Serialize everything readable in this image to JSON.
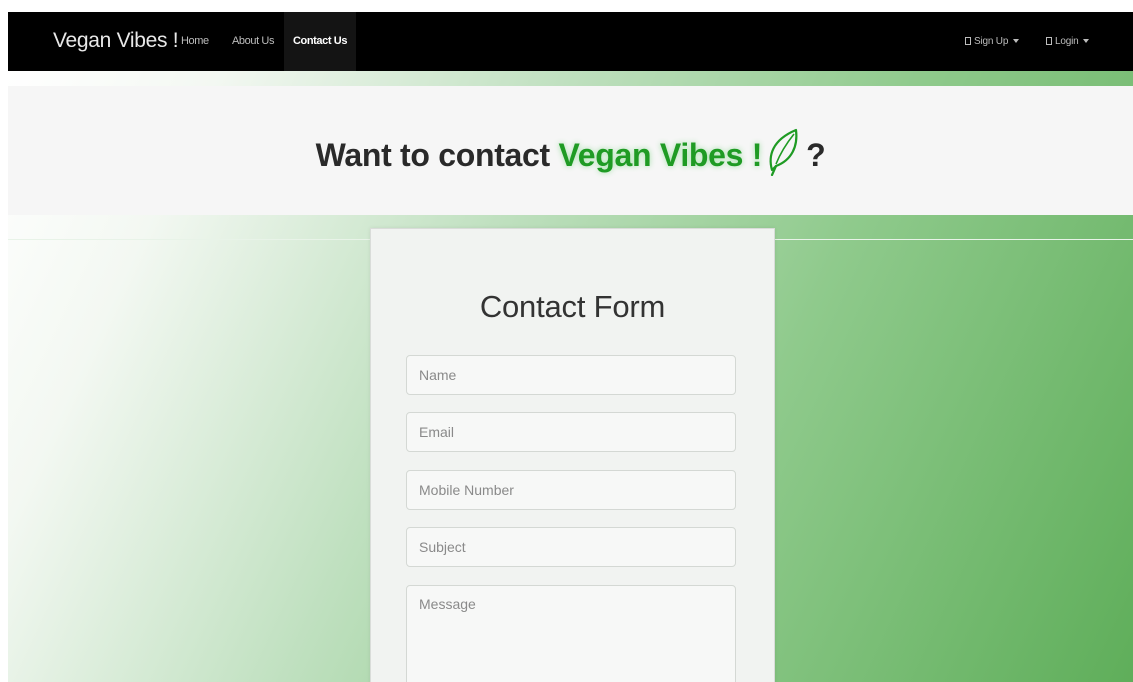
{
  "navbar": {
    "brand": "Vegan Vibes !",
    "links": [
      {
        "label": "Home"
      },
      {
        "label": "About Us"
      },
      {
        "label": "Contact Us",
        "active": true
      }
    ],
    "right": {
      "signup": "Sign Up",
      "login": "Login"
    }
  },
  "hero": {
    "prefix": "Want to contact",
    "brand": "Vegan Vibes !",
    "suffix": "?",
    "icon": "leaf-icon"
  },
  "form": {
    "title": "Contact Form",
    "fields": {
      "name": {
        "placeholder": "Name",
        "value": ""
      },
      "email": {
        "placeholder": "Email",
        "value": ""
      },
      "mobile": {
        "placeholder": "Mobile Number",
        "value": ""
      },
      "subject": {
        "placeholder": "Subject",
        "value": ""
      },
      "message": {
        "placeholder": "Message",
        "value": ""
      }
    }
  },
  "colors": {
    "navbar_bg": "#000000",
    "brand_green": "#1f9b24",
    "gradient_dark": "#5fae5a"
  }
}
